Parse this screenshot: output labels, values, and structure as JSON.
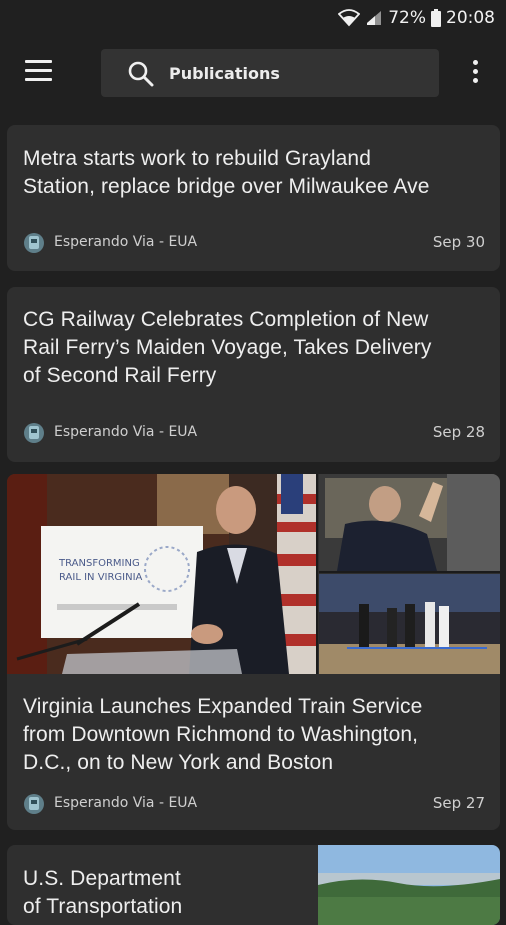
{
  "status": {
    "battery": "72%",
    "time": "20:08"
  },
  "search": {
    "query": "Publications"
  },
  "articles": [
    {
      "title_lines": [
        "Metra starts work to rebuild Grayland",
        "Station, replace bridge over Milwaukee Ave"
      ],
      "source": "Esperando Via - EUA",
      "date": "Sep 30"
    },
    {
      "title_lines": [
        "CG Railway Celebrates Completion of New",
        "Rail Ferry’s Maiden Voyage, Takes Delivery",
        "of Second Rail Ferry"
      ],
      "source": "Esperando Via - EUA",
      "date": "Sep 28"
    },
    {
      "title_lines": [
        "Virginia Launches Expanded Train Service",
        "from Downtown Richmond to Washington,",
        "D.C., on to New York and Boston"
      ],
      "source": "Esperando Via - EUA",
      "date": "Sep 27",
      "image_sign": [
        "TRANSFORMING",
        "RAIL IN VIRGINIA"
      ]
    },
    {
      "title_lines": [
        "U.S. Department",
        "of Transportation"
      ]
    }
  ]
}
